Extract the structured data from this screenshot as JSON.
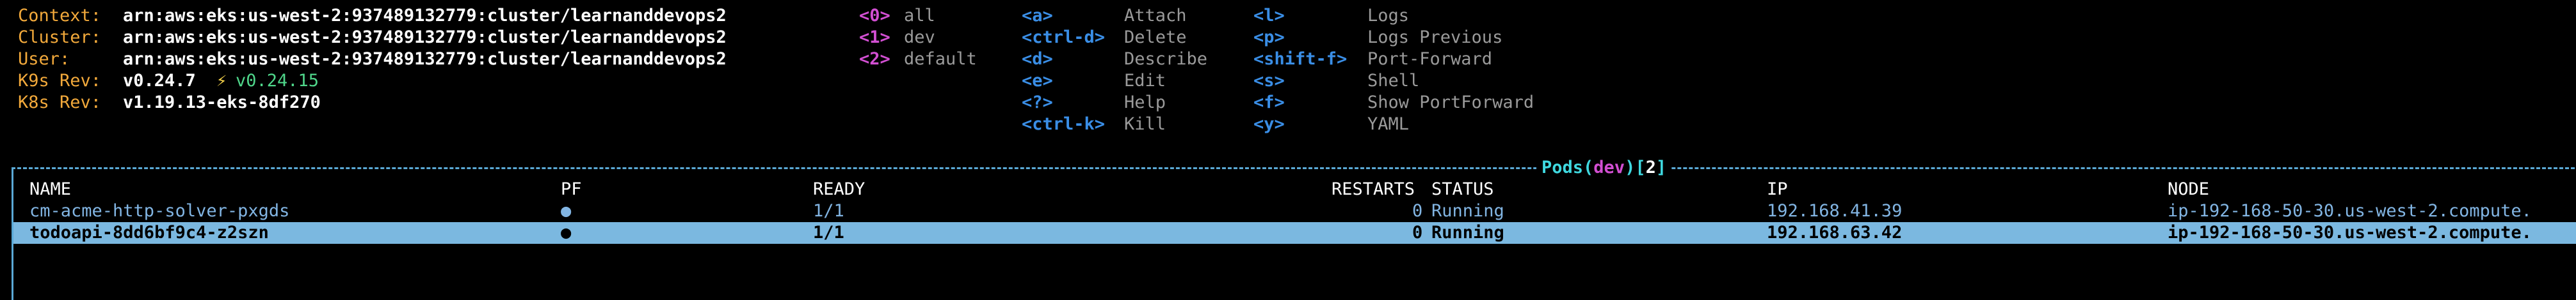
{
  "header": {
    "context_label": "Context:",
    "context_value": "arn:aws:eks:us-west-2:937489132779:cluster/learnanddevops2",
    "cluster_label": "Cluster:",
    "cluster_value": "arn:aws:eks:us-west-2:937489132779:cluster/learnanddevops2",
    "user_label": "User:",
    "user_value": "arn:aws:eks:us-west-2:937489132779:cluster/learnanddevops2",
    "k9s_label": "K9s Rev:",
    "k9s_value": "v0.24.7",
    "k9s_bolt": "⚡",
    "k9s_new": "v0.24.15",
    "k8s_label": "K8s Rev:",
    "k8s_value": "v1.19.13-eks-8df270"
  },
  "namespaces": [
    {
      "key": "<0>",
      "name": "all"
    },
    {
      "key": "<1>",
      "name": "dev"
    },
    {
      "key": "<2>",
      "name": "default"
    }
  ],
  "commands_col1": [
    {
      "key": "<a>",
      "desc": "Attach"
    },
    {
      "key": "<ctrl-d>",
      "desc": "Delete"
    },
    {
      "key": "<d>",
      "desc": "Describe"
    },
    {
      "key": "<e>",
      "desc": "Edit"
    },
    {
      "key": "<?>",
      "desc": "Help"
    },
    {
      "key": "<ctrl-k>",
      "desc": "Kill"
    }
  ],
  "commands_col2": [
    {
      "key": "<l>",
      "desc": "Logs"
    },
    {
      "key": "<p>",
      "desc": "Logs Previous"
    },
    {
      "key": "<shift-f>",
      "desc": "Port-Forward"
    },
    {
      "key": "<s>",
      "desc": "Shell"
    },
    {
      "key": "<f>",
      "desc": "Show PortForward"
    },
    {
      "key": "<y>",
      "desc": "YAML"
    }
  ],
  "panel": {
    "title_resource": "Pods",
    "title_open": "(",
    "title_namespace": "dev",
    "title_close": ")",
    "title_count_open": "[",
    "title_count": "2",
    "title_count_close": "]"
  },
  "table": {
    "columns": {
      "name": "NAME",
      "pf": "PF",
      "ready": "READY",
      "restarts": "RESTARTS",
      "status": "STATUS",
      "ip": "IP",
      "node": "NODE"
    },
    "rows": [
      {
        "name": "cm-acme-http-solver-pxgds",
        "pf": "●",
        "ready": "1/1",
        "restarts": "0",
        "status": "Running",
        "ip": "192.168.41.39",
        "node": "ip-192-168-50-30.us-west-2.compute."
      },
      {
        "name": "todoapi-8dd6bf9c4-z2szn",
        "pf": "●",
        "ready": "1/1",
        "restarts": "0",
        "status": "Running",
        "ip": "192.168.63.42",
        "node": "ip-192-168-50-30.us-west-2.compute."
      }
    ]
  }
}
